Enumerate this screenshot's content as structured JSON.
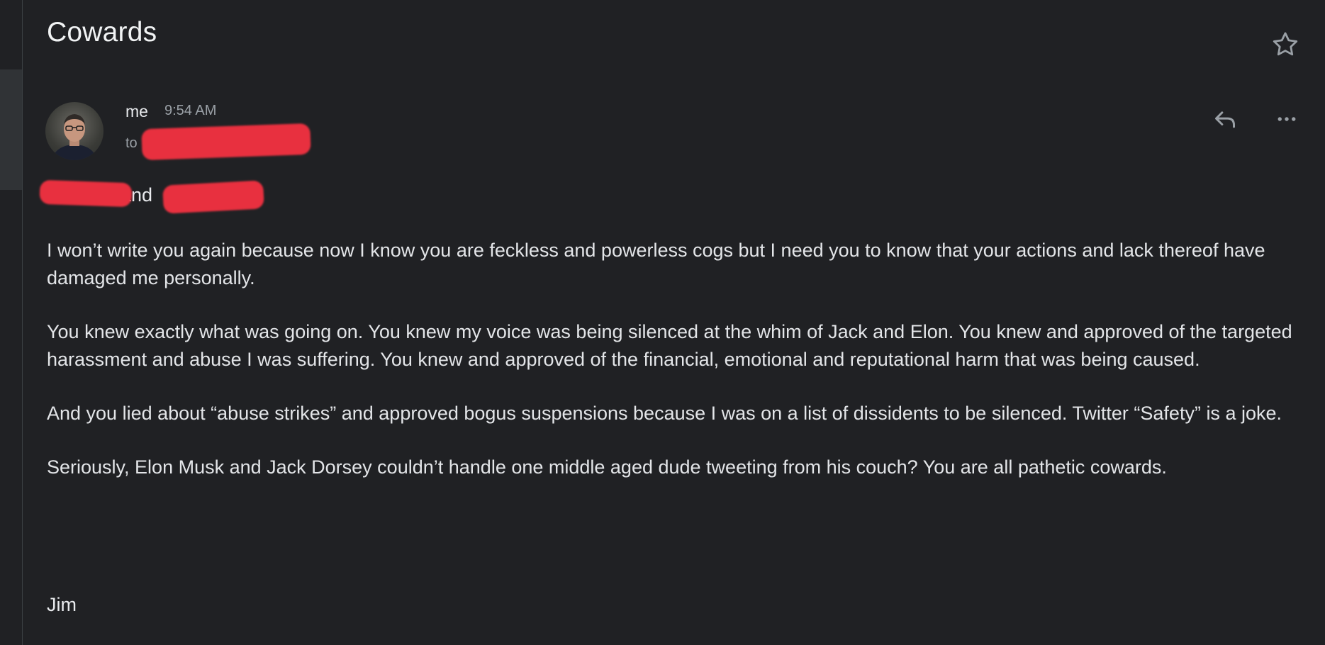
{
  "email": {
    "subject": "Cowards",
    "sender": "me",
    "time": "9:54 AM",
    "to_label": "to",
    "greeting_and": "and",
    "body": [
      "I won’t write you again because now I know you are feckless and powerless cogs but I need you to know that your actions and lack thereof have damaged me personally.",
      "You knew exactly what was going on. You knew my voice was being silenced at the whim of Jack and Elon. You knew and approved of the targeted harassment and abuse I was suffering. You knew and approved of the financial, emotional and reputational harm that was being caused.",
      "And you lied about “abuse strikes” and approved bogus suspensions because I was on a list of dissidents to be silenced. Twitter “Safety” is a joke.",
      "Seriously, Elon Musk and Jack Dorsey couldn’t handle one middle aged dude tweeting from his couch? You are all pathetic cowards."
    ],
    "signature": "Jim"
  },
  "icons": {
    "star": "star-icon",
    "reply": "reply-icon",
    "more": "more-horizontal-icon"
  },
  "colors": {
    "background": "#202124",
    "text": "#e8eaed",
    "muted": "#9aa0a6",
    "redaction": "#e8303f"
  }
}
